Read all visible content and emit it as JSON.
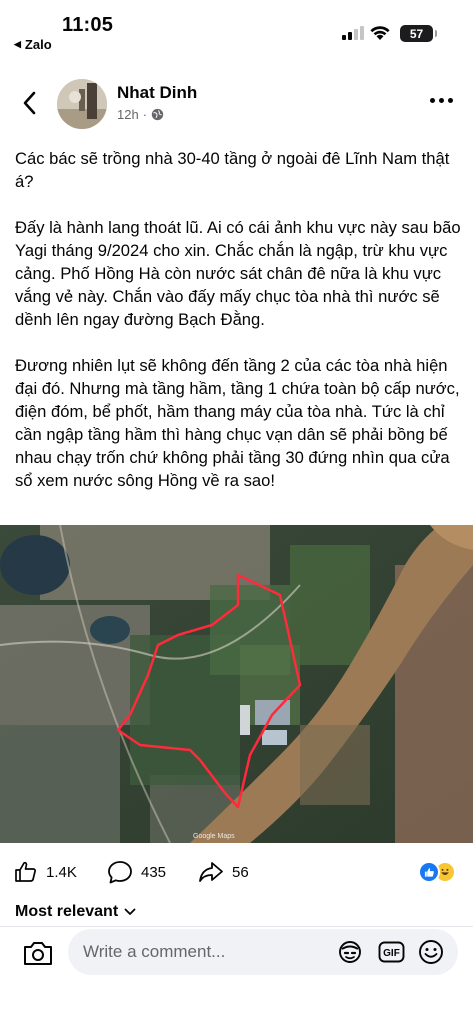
{
  "status_bar": {
    "time": "11:05",
    "back_app": "Zalo",
    "battery": "57"
  },
  "post": {
    "author": "Nhat Dinh",
    "time_ago": "12h",
    "privacy_icon": "globe-icon",
    "paragraphs": [
      "Các bác sẽ trồng nhà 30-40 tầng ở ngoài đê Lĩnh Nam thật á?",
      "Đấy là hành lang thoát lũ. Ai có cái ảnh khu vực này sau bão Yagi tháng 9/2024 cho xin. Chắc chắn là ngập, trừ khu vực cảng. Phố Hồng Hà còn nước sát chân đê nữa là khu vực vắng vẻ này. Chắn vào đấy mấy chục tòa nhà thì nước sẽ dềnh lên ngay đường Bạch Đằng.",
      "Đương nhiên lụt sẽ không đến tầng 2 của các tòa nhà hiện đại đó. Nhưng mà tầng hầm, tầng 1 chứa toàn bộ cấp nước, điện đóm, bể phốt, hầm thang máy của tòa nhà. Tức là chỉ cần ngập tầng hầm thì hàng chục vạn dân sẽ phải bồng bế nhau chạy trốn chứ không phải tầng 30 đứng nhìn qua cửa sổ xem nước sông Hồng về ra sao!"
    ],
    "image_watermark": "Google Maps"
  },
  "engagement": {
    "likes": "1.4K",
    "comments": "435",
    "shares": "56"
  },
  "comments_section": {
    "sort_label": "Most relevant",
    "input_placeholder": "Write a comment...",
    "gif_label": "GIF"
  },
  "colors": {
    "accent": "#1877f2",
    "secondary_text": "#65676b",
    "input_bg": "#f0f2f5",
    "outline_red": "#ff2a3a"
  }
}
